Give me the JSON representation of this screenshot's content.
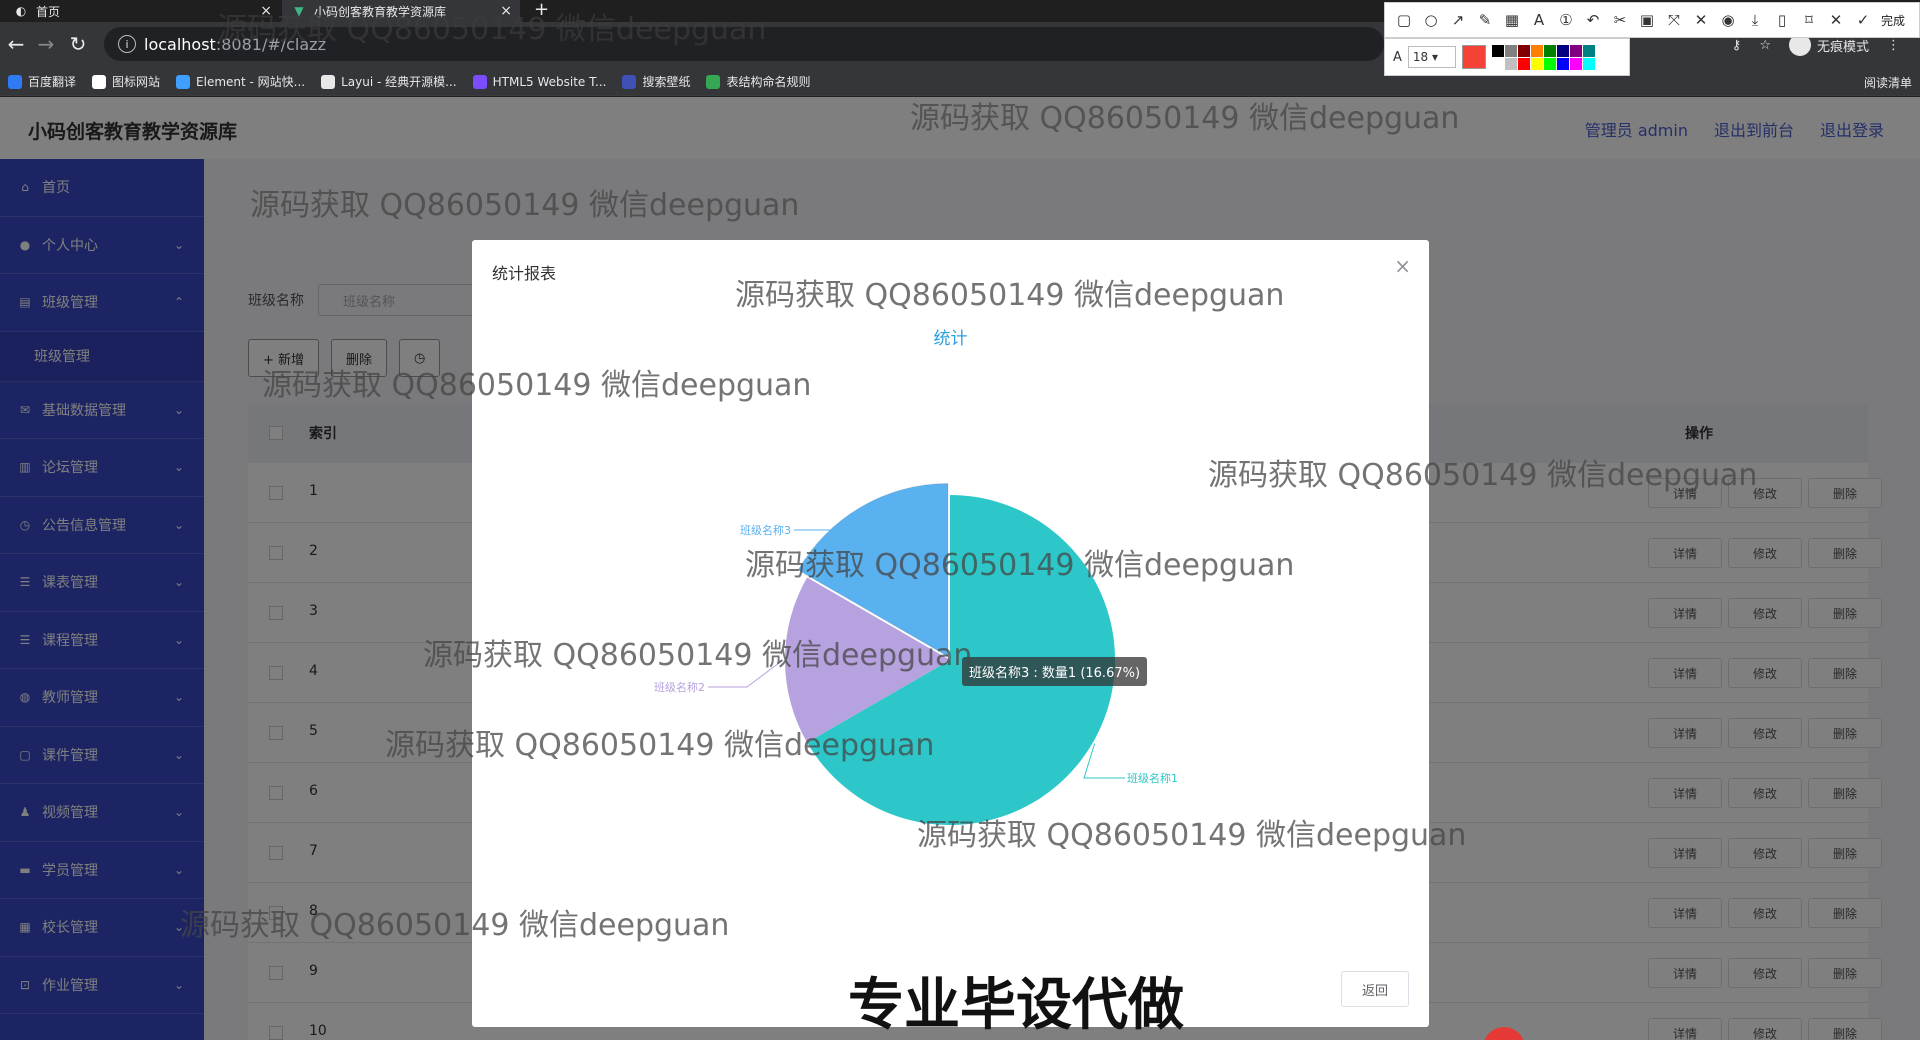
{
  "browser": {
    "tabs": [
      {
        "title": "首页",
        "active": false
      },
      {
        "title": "小码创客教育教学资源库",
        "active": true
      }
    ],
    "url_host": "localhost",
    "url_path": ":8081/#/clazz",
    "incognito_label": "无痕模式",
    "bookmarks": [
      {
        "label": "百度翻译",
        "color": "#2f7bf5"
      },
      {
        "label": "图标网站",
        "color": "#ffffff"
      },
      {
        "label": "Element - 网站快...",
        "color": "#409eff"
      },
      {
        "label": "Layui - 经典开源模...",
        "color": "#e8e8e8"
      },
      {
        "label": "HTML5 Website T...",
        "color": "#7c4dff"
      },
      {
        "label": "搜索壁纸",
        "color": "#3f51b5"
      },
      {
        "label": "表结构命名规则",
        "color": "#34a853"
      }
    ],
    "reading_list": "阅读清单"
  },
  "snip_tool": {
    "done_label": "完成",
    "font_size": "18",
    "current_color": "#f44336",
    "palette": [
      "#000000",
      "#808080",
      "#800000",
      "#ff8000",
      "#008000",
      "#000080",
      "#800080",
      "#008080",
      "#ffffff",
      "#c0c0c0",
      "#ff0000",
      "#ffff00",
      "#00ff00",
      "#0000ff",
      "#ff00ff",
      "#00ffff"
    ]
  },
  "app": {
    "title": "小码创客教育教学资源库",
    "header_links": [
      "管理员 admin",
      "退出到前台",
      "退出登录"
    ],
    "sidebar": [
      {
        "label": "首页",
        "icon": "home-icon",
        "chevron": ""
      },
      {
        "label": "个人中心",
        "icon": "user-icon",
        "chevron": "⌄"
      },
      {
        "label": "班级管理",
        "icon": "class-icon",
        "chevron": "⌃"
      },
      {
        "label": "班级管理",
        "icon": "",
        "chevron": "",
        "sub": true
      },
      {
        "label": "基础数据管理",
        "icon": "data-icon",
        "chevron": "⌄"
      },
      {
        "label": "论坛管理",
        "icon": "forum-icon",
        "chevron": "⌄"
      },
      {
        "label": "公告信息管理",
        "icon": "notice-icon",
        "chevron": "⌄"
      },
      {
        "label": "课表管理",
        "icon": "schedule-icon",
        "chevron": "⌄"
      },
      {
        "label": "课程管理",
        "icon": "course-icon",
        "chevron": "⌄"
      },
      {
        "label": "教师管理",
        "icon": "teacher-icon",
        "chevron": "⌄"
      },
      {
        "label": "课件管理",
        "icon": "courseware-icon",
        "chevron": "⌄"
      },
      {
        "label": "视频管理",
        "icon": "video-icon",
        "chevron": "⌄"
      },
      {
        "label": "学员管理",
        "icon": "student-icon",
        "chevron": "⌄"
      },
      {
        "label": "校长管理",
        "icon": "principal-icon",
        "chevron": "⌄"
      },
      {
        "label": "作业管理",
        "icon": "homework-icon",
        "chevron": "⌄"
      }
    ],
    "search": {
      "label": "班级名称",
      "placeholder": "班级名称"
    },
    "buttons": {
      "add": "+ 新增",
      "delete": "删除"
    },
    "table": {
      "header_index": "索引",
      "header_ops": "操作",
      "rows": [
        "1",
        "2",
        "3",
        "4",
        "5",
        "6",
        "7",
        "8",
        "9",
        "10"
      ],
      "actions": [
        "详情",
        "修改",
        "删除"
      ]
    }
  },
  "modal": {
    "title": "统计报表",
    "close": "×",
    "return_label": "返回",
    "tooltip": "班级名称3 : 数量1 (16.67%)"
  },
  "chart_data": {
    "type": "pie",
    "title": "统计",
    "series": [
      {
        "values": [
          {
            "name": "班级名称1",
            "value": 4,
            "color": "#2ec7c9"
          },
          {
            "name": "班级名称2",
            "value": 1,
            "color": "#b6a2de"
          },
          {
            "name": "班级名称3",
            "value": 1,
            "color": "#5ab1ef"
          }
        ]
      }
    ],
    "highlighted": "班级名称3"
  },
  "overlays": {
    "watermark": "源码获取 QQ86050149 微信deepguan",
    "banner": "专业毕设代做"
  }
}
